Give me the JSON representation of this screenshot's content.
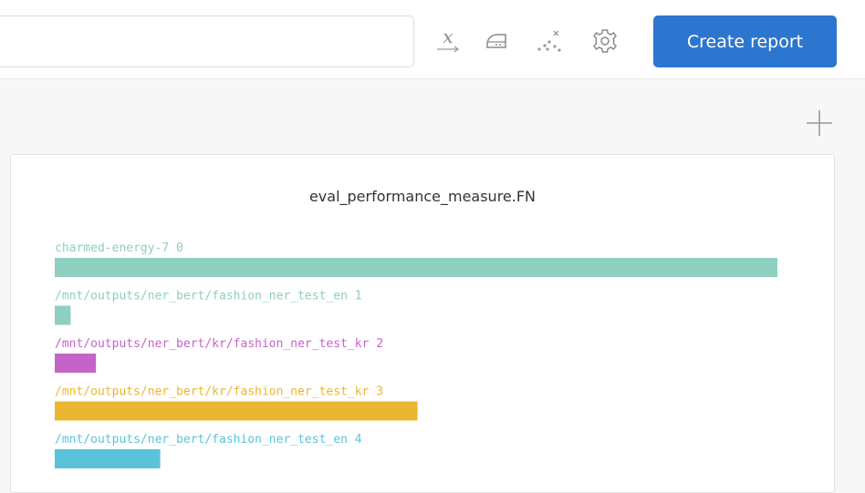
{
  "toolbar": {
    "icons": [
      "x-axis-icon",
      "smoothing-icon",
      "outliers-icon",
      "settings-icon"
    ],
    "create_report_label": "Create report"
  },
  "panel": {
    "add_icon": "plus-icon"
  },
  "chart_data": {
    "type": "bar",
    "title": "eval_performance_measure.FN",
    "orientation": "horizontal",
    "grid": false,
    "series": [
      {
        "name": "charmed-energy-7 0",
        "value": 100,
        "color": "#8ecfbf"
      },
      {
        "name": "/mnt/outputs/ner_bert/fashion_ner_test_en 1",
        "value": 2.2,
        "color": "#8ecfbf"
      },
      {
        "name": "/mnt/outputs/ner_bert/kr/fashion_ner_test_kr 2",
        "value": 5.7,
        "color": "#c564c8"
      },
      {
        "name": "/mnt/outputs/ner_bert/kr/fashion_ner_test_kr 3",
        "value": 50.2,
        "color": "#ebb731"
      },
      {
        "name": "/mnt/outputs/ner_bert/fashion_ner_test_en 4",
        "value": 14.6,
        "color": "#5bc3d9"
      }
    ],
    "xlim": [
      0,
      100
    ]
  }
}
